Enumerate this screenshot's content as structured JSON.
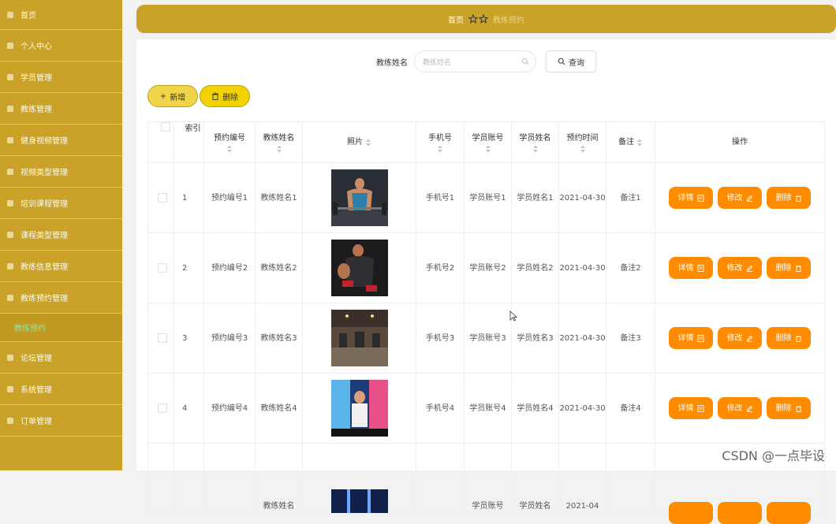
{
  "sidebar": {
    "items": [
      {
        "label": "首页"
      },
      {
        "label": "个人中心"
      },
      {
        "label": "学员管理"
      },
      {
        "label": "教练管理"
      },
      {
        "label": "健身视频管理"
      },
      {
        "label": "视频类型管理"
      },
      {
        "label": "培训课程管理"
      },
      {
        "label": "课程类型管理"
      },
      {
        "label": "教练信息管理"
      },
      {
        "label": "教练预约管理"
      },
      {
        "label": "论坛管理"
      },
      {
        "label": "系统管理"
      },
      {
        "label": "订单管理"
      }
    ],
    "active_sub": "教练预约"
  },
  "header": {
    "crumb_home": "首页",
    "crumb_current": "教练预约"
  },
  "search": {
    "label": "教练姓名",
    "placeholder": "教练姓名",
    "button": "查询"
  },
  "actions": {
    "add": "新增",
    "delete": "删除"
  },
  "table": {
    "columns": {
      "index": "索引",
      "booking_no": "预约编号",
      "coach_name": "教练姓名",
      "photo": "照片",
      "phone": "手机号",
      "student_account": "学员账号",
      "student_name": "学员姓名",
      "booking_time": "预约时间",
      "note": "备注",
      "ops": "操作"
    },
    "rows": [
      {
        "index": "1",
        "booking_no": "预约编号1",
        "coach_name": "教练姓名1",
        "phone": "手机号1",
        "student_account": "学员账号1",
        "student_name": "学员姓名1",
        "booking_time": "2021-04-30",
        "note": "备注1"
      },
      {
        "index": "2",
        "booking_no": "预约编号2",
        "coach_name": "教练姓名2",
        "phone": "手机号2",
        "student_account": "学员账号2",
        "student_name": "学员姓名2",
        "booking_time": "2021-04-30",
        "note": "备注2"
      },
      {
        "index": "3",
        "booking_no": "预约编号3",
        "coach_name": "教练姓名3",
        "phone": "手机号3",
        "student_account": "学员账号3",
        "student_name": "学员姓名3",
        "booking_time": "2021-04-30",
        "note": "备注3"
      },
      {
        "index": "4",
        "booking_no": "预约编号4",
        "coach_name": "教练姓名4",
        "phone": "手机号4",
        "student_account": "学员账号4",
        "student_name": "学员姓名4",
        "booking_time": "2021-04-30",
        "note": "备注4"
      },
      {
        "index": "",
        "booking_no": "",
        "coach_name": "教练姓名",
        "phone": "",
        "student_account": "学员账号",
        "student_name": "学员姓名",
        "booking_time": "2021-04",
        "note": ""
      }
    ],
    "op_labels": {
      "detail": "详情",
      "edit": "修改",
      "delete": "删除"
    }
  },
  "colors": {
    "sidebar": "#c9a227",
    "header": "#c9a227",
    "op_button": "#ff8c00",
    "add_button": "#f0d548",
    "delete_button": "#f2d200"
  },
  "watermark": "CSDN @一点毕设"
}
